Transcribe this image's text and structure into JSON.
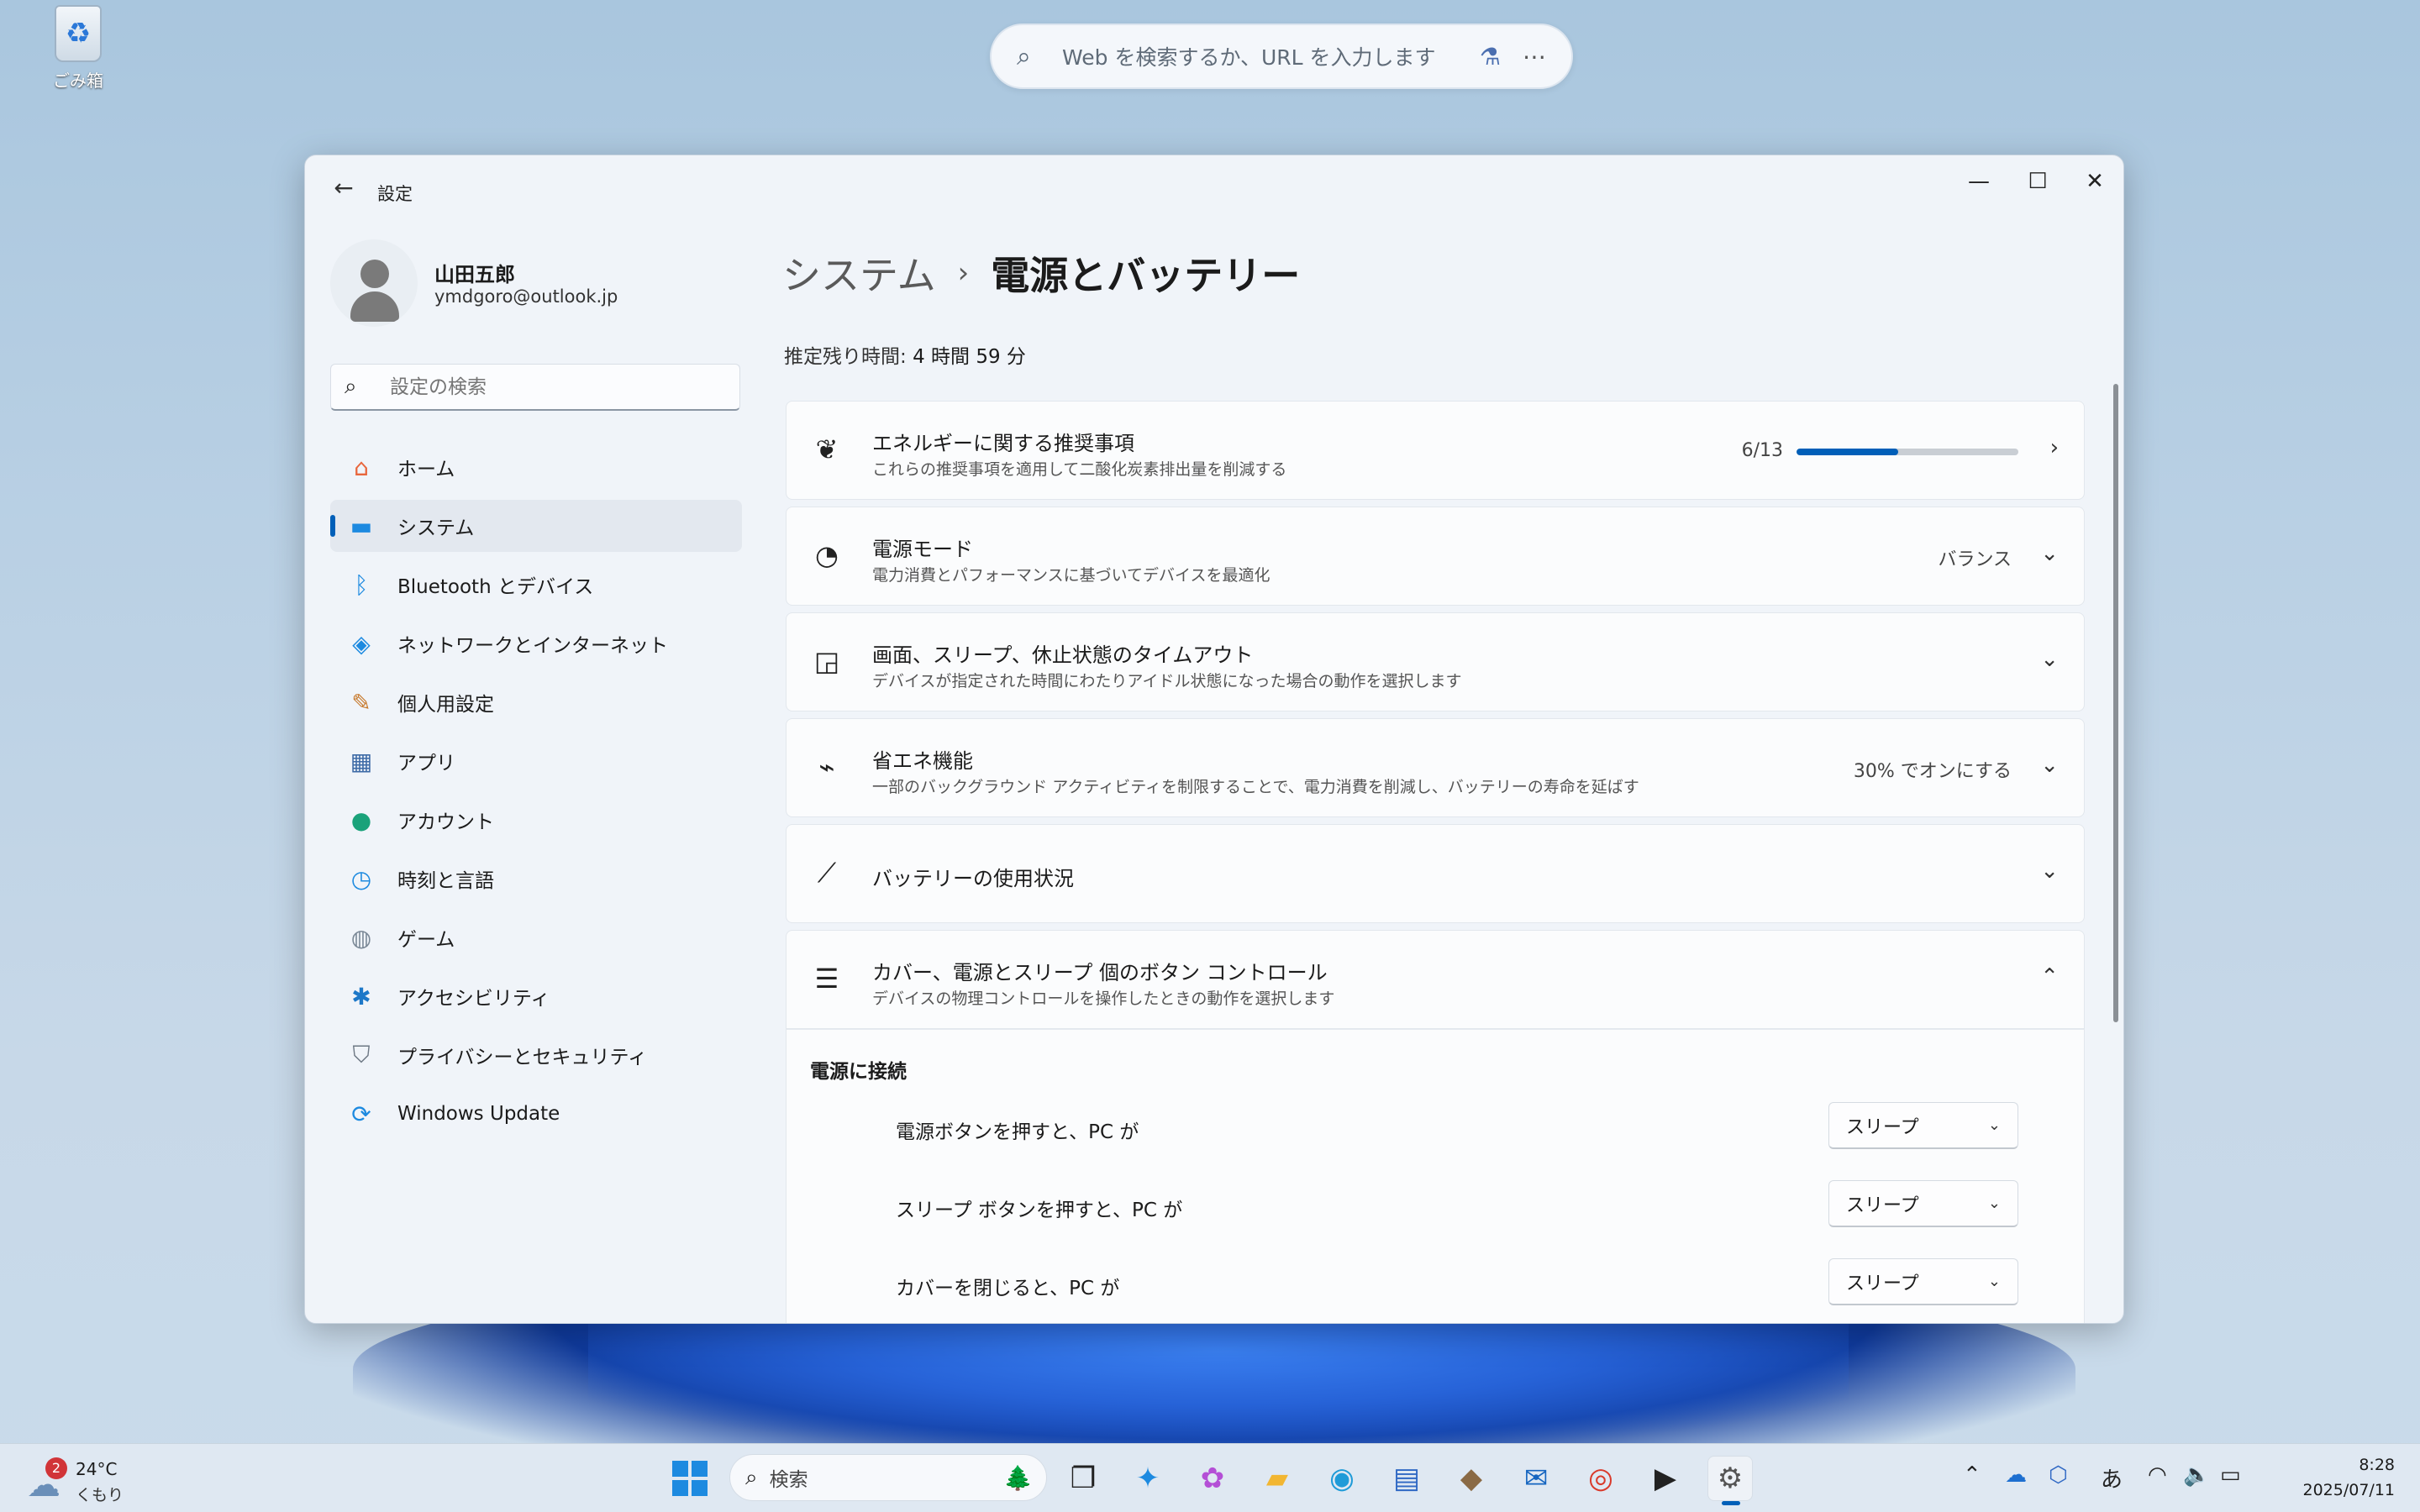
{
  "desktop": {
    "recycle_bin_label": "ごみ箱"
  },
  "browser_search": {
    "placeholder": "Web を検索するか、URL を入力します",
    "search_icon": "search-icon",
    "extension_icon": "extension-icon",
    "more_icon": "more-icon"
  },
  "window": {
    "title": "設定",
    "back_icon": "←",
    "minimize_icon": "—",
    "maximize_icon": "☐",
    "close_icon": "✕"
  },
  "profile": {
    "name": "山田五郎",
    "email": "ymdgoro@outlook.jp"
  },
  "search": {
    "placeholder": "設定の検索"
  },
  "nav": {
    "items": [
      {
        "label": "ホーム",
        "icon": "home-icon",
        "glyph": "⌂",
        "color": "#e8663c"
      },
      {
        "label": "システム",
        "icon": "system-icon",
        "glyph": "▬",
        "color": "#1d8ae0"
      },
      {
        "label": "Bluetooth とデバイス",
        "icon": "bluetooth-icon",
        "glyph": "ᛒ",
        "color": "#1d8ae0"
      },
      {
        "label": "ネットワークとインターネット",
        "icon": "wifi-icon",
        "glyph": "◈",
        "color": "#1d8ae0"
      },
      {
        "label": "個人用設定",
        "icon": "brush-icon",
        "glyph": "✎",
        "color": "#c7792c"
      },
      {
        "label": "アプリ",
        "icon": "apps-icon",
        "glyph": "▦",
        "color": "#3d6aa6"
      },
      {
        "label": "アカウント",
        "icon": "account-icon",
        "glyph": "●",
        "color": "#1aa27a"
      },
      {
        "label": "時刻と言語",
        "icon": "clock-globe-icon",
        "glyph": "◷",
        "color": "#1d8ae0"
      },
      {
        "label": "ゲーム",
        "icon": "gamepad-icon",
        "glyph": "◍",
        "color": "#7a8896"
      },
      {
        "label": "アクセシビリティ",
        "icon": "accessibility-icon",
        "glyph": "✱",
        "color": "#1d78c8"
      },
      {
        "label": "プライバシーとセキュリティ",
        "icon": "shield-icon",
        "glyph": "⛉",
        "color": "#6d7884"
      },
      {
        "label": "Windows Update",
        "icon": "update-icon",
        "glyph": "⟳",
        "color": "#1d8ae0"
      }
    ],
    "active_index": 1
  },
  "breadcrumb": {
    "parent": "システム",
    "separator": "›",
    "current": "電源とバッテリー"
  },
  "battery": {
    "remaining_label": "推定残り時間: ",
    "remaining_value": "4 時間 59 分"
  },
  "cards": {
    "energy": {
      "title": "エネルギーに関する推奨事項",
      "subtitle": "これらの推奨事項を適用して二酸化炭素排出量を削減する",
      "progress_text": "6/13",
      "progress_fraction": 0.46,
      "icon": "leaf-icon"
    },
    "power_mode": {
      "title": "電源モード",
      "subtitle": "電力消費とパフォーマンスに基づいてデバイスを最適化",
      "value": "バランス",
      "icon": "gauge-icon"
    },
    "timeouts": {
      "title": "画面、スリープ、休止状態のタイムアウト",
      "subtitle": "デバイスが指定された時間にわたりアイドル状態になった場合の動作を選択します",
      "icon": "screen-sleep-icon"
    },
    "saver": {
      "title": "省エネ機能",
      "subtitle": "一部のバックグラウンド アクティビティを制限することで、電力消費を削減し、バッテリーの寿命を延ばす",
      "value": "30% でオンにする",
      "icon": "battery-saver-icon"
    },
    "usage": {
      "title": "バッテリーの使用状況",
      "icon": "chart-icon"
    },
    "buttons": {
      "title": "カバー、電源とスリープ 個のボタン コントロール",
      "subtitle": "デバイスの物理コントロールを操作したときの動作を選択します",
      "icon": "list-icon",
      "section_title": "電源に接続",
      "rows": [
        {
          "label": "電源ボタンを押すと、PC が",
          "value": "スリープ"
        },
        {
          "label": "スリープ ボタンを押すと、PC が",
          "value": "スリープ"
        },
        {
          "label": "カバーを閉じると、PC が",
          "value": "スリープ"
        }
      ]
    }
  },
  "taskbar": {
    "weather": {
      "badge": "2",
      "temp": "24°C",
      "condition": "くもり"
    },
    "search_label": "検索",
    "apps": [
      {
        "name": "task-view-icon",
        "glyph": "❐",
        "color": "#222"
      },
      {
        "name": "edge-pre-icon",
        "glyph": "✦",
        "color": "#1d8ae0"
      },
      {
        "name": "copilot-icon",
        "glyph": "✿",
        "color": "#b44fd6"
      },
      {
        "name": "file-explorer-icon",
        "glyph": "▰",
        "color": "#f2b632"
      },
      {
        "name": "edge-icon",
        "glyph": "◉",
        "color": "#1f9bd8"
      },
      {
        "name": "store-icon",
        "glyph": "▤",
        "color": "#2f68c4"
      },
      {
        "name": "game-icon",
        "glyph": "◆",
        "color": "#8a6a45"
      },
      {
        "name": "outlook-icon",
        "glyph": "✉",
        "color": "#1565c0"
      },
      {
        "name": "chrome-icon",
        "glyph": "◎",
        "color": "#d93a2b"
      },
      {
        "name": "terminal-icon",
        "glyph": "▶",
        "color": "#222"
      },
      {
        "name": "settings-icon",
        "glyph": "⚙",
        "color": "#555"
      }
    ],
    "tray": {
      "ime": "あ"
    },
    "time": "8:28",
    "date": "2025/07/11"
  }
}
